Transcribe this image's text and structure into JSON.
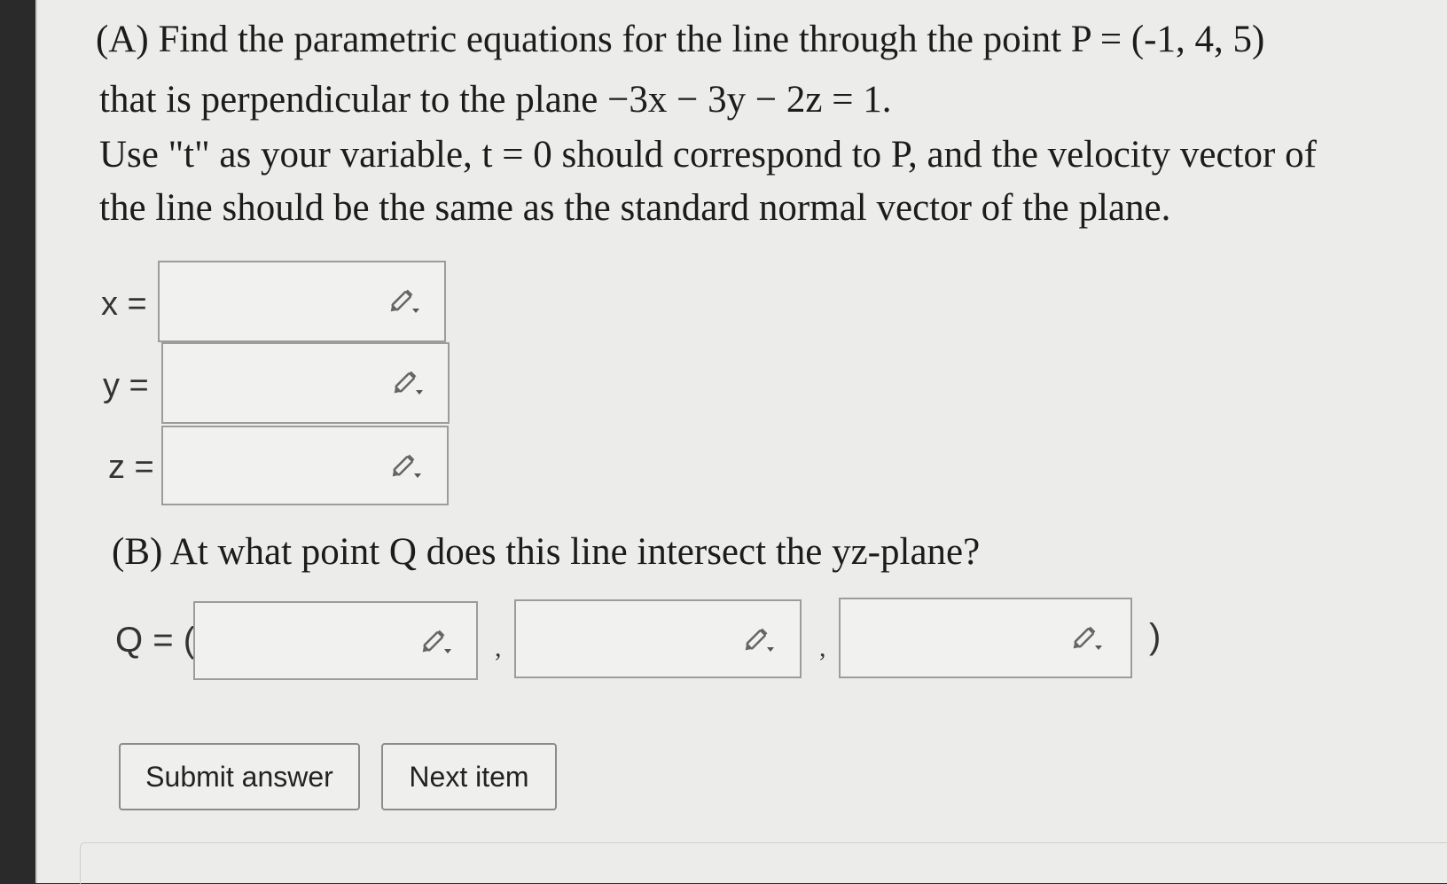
{
  "question": {
    "part_a": {
      "lines": [
        "(A) Find the parametric equations for the line through the point P = (-1, 4, 5)",
        "that is perpendicular to the plane −3x − 3y − 2z = 1.",
        "Use \"t\" as your variable, t = 0 should correspond to P, and the velocity vector of",
        "the line should be the same as the standard normal vector of the plane."
      ]
    },
    "inputs": {
      "x_label": "x =",
      "y_label": "y =",
      "z_label": "z ="
    },
    "part_b": {
      "text": "(B) At what point Q does this line intersect the yz-plane?",
      "q_label": "Q = (",
      "separator_1": ",",
      "separator_2": ",",
      "close_paren": ")"
    }
  },
  "icons": {
    "answer_tool": "pencil-dropdown-icon"
  },
  "buttons": {
    "submit": "Submit answer",
    "next": "Next item"
  }
}
